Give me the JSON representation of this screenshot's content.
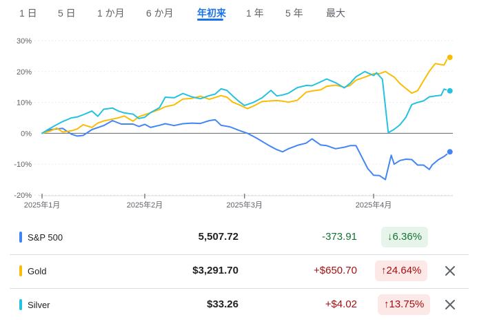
{
  "tabs": [
    {
      "label": "1 日"
    },
    {
      "label": "5 日"
    },
    {
      "label": "1 か月"
    },
    {
      "label": "6 か月"
    },
    {
      "label": "年初来"
    },
    {
      "label": "1 年"
    },
    {
      "label": "5 年"
    },
    {
      "label": "最大"
    }
  ],
  "active_tab": "年初来",
  "colors": {
    "sp500": "#4285f4",
    "gold": "#fbbc04",
    "silver": "#24c1e0",
    "positive_text": "#137333",
    "positive_bg": "#e6f4ea",
    "negative_text": "#a50e0e",
    "negative_bg": "#fce8e6"
  },
  "rows": [
    {
      "name": "S&P 500",
      "price": "5,507.72",
      "change": "-373.91",
      "pct": "6.36%",
      "arrow": "↓",
      "tone": "positive",
      "color": "#4285f4",
      "removable": false
    },
    {
      "name": "Gold",
      "price": "$3,291.70",
      "change": "+$650.70",
      "pct": "24.64%",
      "arrow": "↑",
      "tone": "negative",
      "color": "#fbbc04",
      "removable": true
    },
    {
      "name": "Silver",
      "price": "$33.26",
      "change": "+$4.02",
      "pct": "13.75%",
      "arrow": "↑",
      "tone": "negative",
      "color": "#24c1e0",
      "removable": true
    }
  ],
  "chart_data": {
    "type": "line",
    "y_tick_labels": [
      "30%",
      "20%",
      "10%",
      "0%",
      "-10%",
      "-20%"
    ],
    "y_ticks": [
      30,
      20,
      10,
      0,
      -10,
      -20
    ],
    "ylim": [
      -20,
      30
    ],
    "x_tick_labels": [
      "2025年1月",
      "2025年2月",
      "2025年3月",
      "2025年4月"
    ],
    "x_ticks": [
      0,
      35,
      69,
      113
    ],
    "xlim": [
      0,
      140
    ],
    "zero_line": true,
    "series": [
      {
        "name": "S&P 500",
        "color": "#4285f4",
        "x": [
          0,
          3,
          7,
          10,
          12,
          14,
          17,
          21,
          24,
          27,
          31,
          33,
          35,
          37,
          40,
          42,
          45,
          48,
          51,
          54,
          57,
          59,
          61,
          64,
          67,
          70,
          73,
          76,
          78,
          80,
          82,
          84,
          87,
          90,
          92,
          95,
          97,
          100,
          103,
          105,
          107,
          111,
          113,
          115,
          117,
          119,
          120,
          122,
          124,
          126,
          128,
          130,
          132,
          133,
          135,
          137,
          139
        ],
        "y": [
          0,
          1.2,
          1.6,
          -0.3,
          -0.9,
          -0.7,
          1.2,
          2.5,
          4.1,
          3.0,
          3.0,
          2.2,
          2.9,
          1.9,
          2.6,
          3.1,
          2.5,
          3.1,
          3.3,
          3.2,
          4.1,
          4.4,
          2.6,
          2.1,
          1.0,
          0,
          -1.5,
          -3.2,
          -4.3,
          -5.3,
          -6.0,
          -5.0,
          -3.9,
          -3.2,
          -1.8,
          -3.8,
          -4.0,
          -5.0,
          -4.5,
          -4.0,
          -4.0,
          -11.4,
          -13.6,
          -13.7,
          -15.0,
          -7.1,
          -10.0,
          -8.8,
          -8.4,
          -8.5,
          -10.3,
          -10.3,
          -11.7,
          -10.2,
          -8.6,
          -7.5,
          -6.0
        ]
      },
      {
        "name": "Gold",
        "color": "#fbbc04",
        "x": [
          0,
          3,
          5,
          7,
          10,
          12,
          14,
          17,
          19,
          21,
          24,
          26,
          28,
          31,
          33,
          35,
          37,
          40,
          42,
          45,
          48,
          51,
          54,
          57,
          59,
          61,
          63,
          65,
          67,
          70,
          72,
          75,
          78,
          80,
          82,
          84,
          87,
          90,
          92,
          95,
          97,
          100,
          103,
          105,
          107,
          110,
          113,
          115,
          117,
          120,
          122,
          124,
          126,
          128,
          130,
          132,
          134,
          135,
          137,
          138,
          139
        ],
        "y": [
          0,
          0.8,
          1.7,
          0.4,
          0.8,
          1.4,
          2.8,
          1.9,
          3.3,
          4.0,
          4.6,
          5.0,
          5.6,
          3.9,
          5.4,
          6.0,
          6.7,
          7.7,
          8.6,
          9.2,
          11.1,
          11.3,
          12.0,
          11.0,
          11.6,
          12.2,
          11.7,
          10.1,
          9.3,
          8.0,
          8.8,
          10.3,
          10.5,
          10.6,
          10.4,
          10.1,
          10.7,
          13.3,
          13.7,
          14.1,
          15.2,
          15.6,
          14.9,
          15.5,
          17.2,
          18.2,
          19.3,
          19.3,
          20.0,
          18.2,
          16.1,
          14.5,
          13.0,
          13.8,
          17.0,
          20.1,
          22.6,
          22.4,
          22.1,
          24.0,
          24.6
        ]
      },
      {
        "name": "Silver",
        "color": "#24c1e0",
        "x": [
          0,
          2,
          5,
          7,
          10,
          12,
          14,
          17,
          19,
          21,
          24,
          26,
          28,
          31,
          33,
          35,
          37,
          40,
          42,
          45,
          48,
          51,
          54,
          57,
          59,
          61,
          63,
          65,
          67,
          69,
          72,
          75,
          78,
          80,
          82,
          84,
          87,
          90,
          92,
          95,
          97,
          100,
          103,
          105,
          107,
          110,
          113,
          114,
          116,
          118,
          120,
          122,
          124,
          126,
          128,
          130,
          132,
          134,
          136,
          137,
          139
        ],
        "y": [
          0,
          1.2,
          2.8,
          3.8,
          5.0,
          5.3,
          6.0,
          7.2,
          5.5,
          7.8,
          8.2,
          7.2,
          6.6,
          6.2,
          4.8,
          5.2,
          6.7,
          8.3,
          11.7,
          11.5,
          12.9,
          11.8,
          11.2,
          12.2,
          12.7,
          14.4,
          13.9,
          12.1,
          10.4,
          9.0,
          10.0,
          11.5,
          13.9,
          12.1,
          12.4,
          13.0,
          14.8,
          15.5,
          15.4,
          16.7,
          17.6,
          16.4,
          14.7,
          16.2,
          18.3,
          20.0,
          18.7,
          19.6,
          17.5,
          0.2,
          1.3,
          2.8,
          5.2,
          9.3,
          10.0,
          10.5,
          11.8,
          12.1,
          12.3,
          14.3,
          13.75
        ]
      }
    ]
  }
}
